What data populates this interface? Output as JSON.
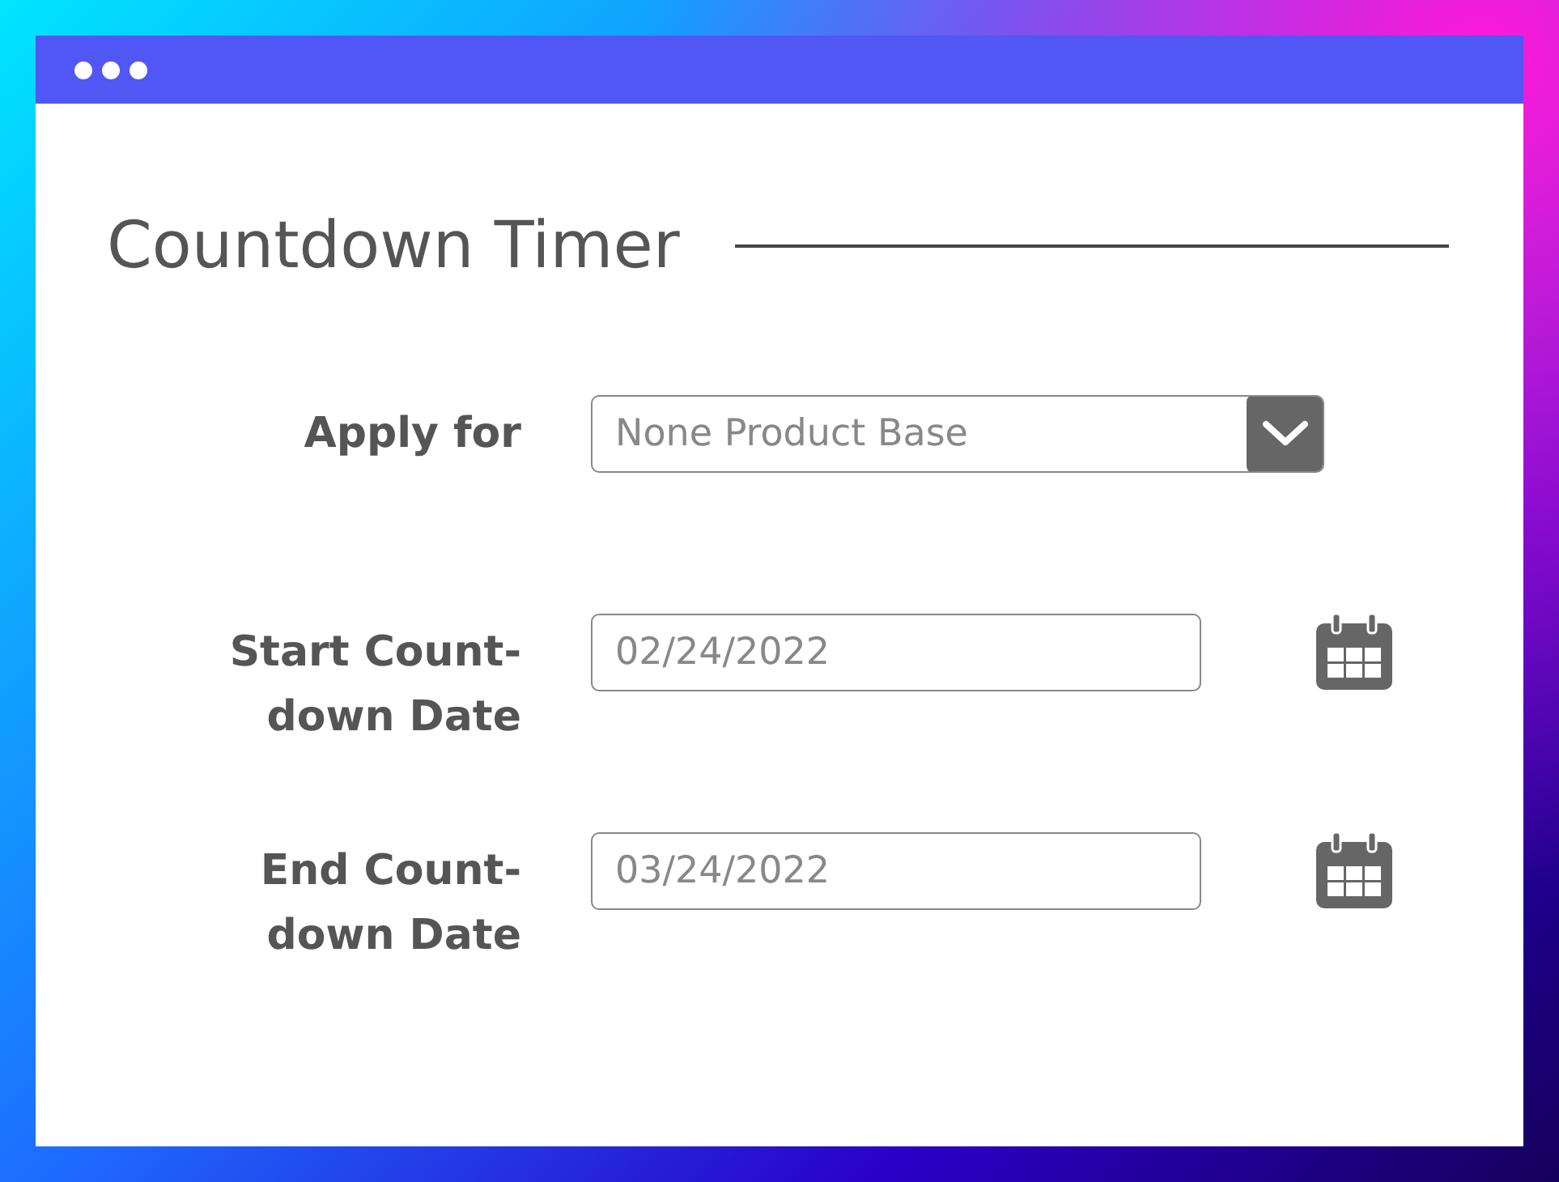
{
  "window": {
    "title": "Countdown Timer"
  },
  "fields": [
    {
      "kind": "select",
      "label": "Apply for",
      "value": "None Product Base"
    },
    {
      "kind": "date",
      "label": "Start Count-down Date",
      "value": "02/24/2022"
    },
    {
      "kind": "date",
      "label": "End Count-down Date",
      "value": "03/24/2022"
    }
  ]
}
